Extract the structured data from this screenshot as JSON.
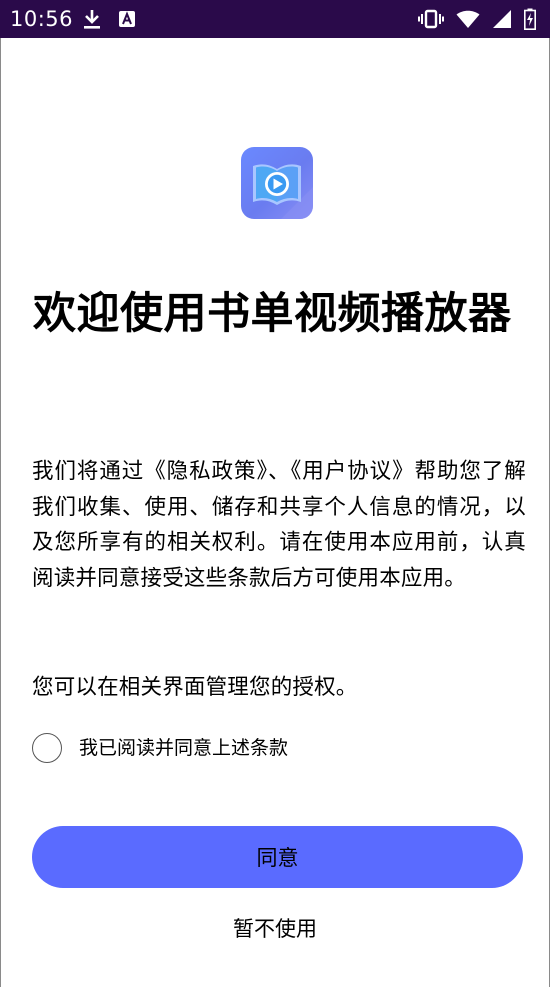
{
  "status_bar": {
    "time": "10:56",
    "left_icons": [
      "download-icon",
      "a-notification-icon"
    ],
    "right_icons": [
      "vibrate-icon",
      "wifi-icon",
      "signal-icon",
      "battery-charging-icon"
    ],
    "background_color": "#2a0a4a"
  },
  "app": {
    "logo_icon": "book-video-player-logo-icon",
    "logo_color": "#6a7cf0"
  },
  "title": "欢迎使用书单视频播放器",
  "body": {
    "paragraph1": "我们将通过《隐私政策》、《用户协议》帮助您了解我们收集、使用、储存和共享个人信息的情况，以及您所享有的相关权利。请在使用本应用前，认真阅读并同意接受这些条款后方可使用本应用。",
    "paragraph2": "您可以在相关界面管理您的授权。"
  },
  "consent": {
    "label": "我已阅读并同意上述条款",
    "checked": false
  },
  "buttons": {
    "agree_label": "同意",
    "agree_color": "#5a6bff",
    "decline_label": "暂不使用"
  }
}
